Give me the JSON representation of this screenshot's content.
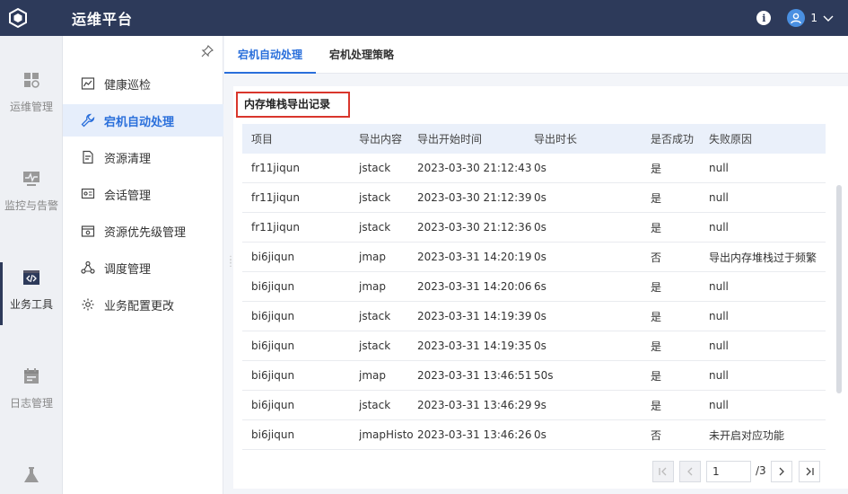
{
  "app": {
    "title": "运维平台",
    "user_number": "1"
  },
  "rail": [
    {
      "label": "运维管理",
      "icon": "dashboard-icon"
    },
    {
      "label": "监控与告警",
      "icon": "monitor-icon"
    },
    {
      "label": "业务工具",
      "icon": "code-icon",
      "active": true
    },
    {
      "label": "日志管理",
      "icon": "calendar-icon"
    },
    {
      "label": "",
      "icon": "flask-icon"
    }
  ],
  "subnav": [
    {
      "label": "健康巡检",
      "icon": "chart-icon"
    },
    {
      "label": "宕机自动处理",
      "icon": "wrench-icon",
      "active": true
    },
    {
      "label": "资源清理",
      "icon": "doc-clean-icon"
    },
    {
      "label": "会话管理",
      "icon": "session-icon"
    },
    {
      "label": "资源优先级管理",
      "icon": "priority-icon"
    },
    {
      "label": "调度管理",
      "icon": "schedule-icon"
    },
    {
      "label": "业务配置更改",
      "icon": "config-icon"
    }
  ],
  "tabs": [
    {
      "label": "宕机自动处理",
      "active": true
    },
    {
      "label": "宕机处理策略"
    }
  ],
  "section_title": "内存堆栈导出记录",
  "table": {
    "headers": [
      "项目",
      "导出内容",
      "导出开始时间",
      "导出时长",
      "是否成功",
      "失败原因"
    ],
    "rows": [
      [
        "fr11jiqun",
        "jstack",
        "2023-03-30 21:12:43",
        "0s",
        "是",
        "null"
      ],
      [
        "fr11jiqun",
        "jstack",
        "2023-03-30 21:12:39",
        "0s",
        "是",
        "null"
      ],
      [
        "fr11jiqun",
        "jstack",
        "2023-03-30 21:12:36",
        "0s",
        "是",
        "null"
      ],
      [
        "bi6jiqun",
        "jmap",
        "2023-03-31 14:20:19",
        "0s",
        "否",
        "导出内存堆栈过于频繁"
      ],
      [
        "bi6jiqun",
        "jmap",
        "2023-03-31 14:20:06",
        "6s",
        "是",
        "null"
      ],
      [
        "bi6jiqun",
        "jstack",
        "2023-03-31 14:19:39",
        "0s",
        "是",
        "null"
      ],
      [
        "bi6jiqun",
        "jstack",
        "2023-03-31 14:19:35",
        "0s",
        "是",
        "null"
      ],
      [
        "bi6jiqun",
        "jmap",
        "2023-03-31 13:46:51",
        "50s",
        "是",
        "null"
      ],
      [
        "bi6jiqun",
        "jstack",
        "2023-03-31 13:46:29",
        "9s",
        "是",
        "null"
      ],
      [
        "bi6jiqun",
        "jmapHisto",
        "2023-03-31 13:46:26",
        "0s",
        "否",
        "未开启对应功能"
      ]
    ]
  },
  "pager": {
    "current": "1",
    "total": "/3"
  }
}
